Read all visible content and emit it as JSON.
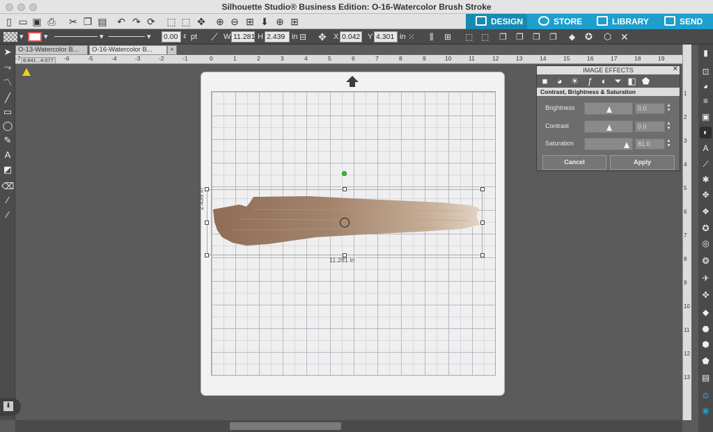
{
  "window": {
    "title": "Silhouette Studio® Business Edition: O-16-Watercolor Brush Stroke"
  },
  "nav_tabs": [
    {
      "label": "DESIGN",
      "icon": "grid-icon",
      "active": true
    },
    {
      "label": "STORE",
      "icon": "store-icon"
    },
    {
      "label": "LIBRARY",
      "icon": "library-icon"
    },
    {
      "label": "SEND",
      "icon": "send-icon"
    }
  ],
  "toolbar": {
    "line_width": "0.00",
    "line_unit": "pt",
    "w_label": "W",
    "w_value": "11.281",
    "h_label": "H",
    "h_value": "2.439",
    "size_unit": "in",
    "x_label": "X",
    "x_value": "0.042",
    "y_label": "Y",
    "y_value": "4.301",
    "pos_unit": "in"
  },
  "doc_tabs": [
    {
      "label": "O-13-Watercolor B..."
    },
    {
      "label": "O-16-Watercolor B..."
    },
    {
      "label": "+"
    }
  ],
  "ruler": {
    "h_ticks": [
      "-7",
      "-6",
      "-5",
      "-4",
      "-3",
      "-2",
      "-1",
      "0",
      "1",
      "2",
      "3",
      "4",
      "5",
      "6",
      "7",
      "8",
      "9",
      "10",
      "11",
      "12",
      "13",
      "14",
      "15",
      "16",
      "17",
      "18",
      "19"
    ],
    "v_ticks": [
      "1",
      "2",
      "3",
      "4",
      "5",
      "6",
      "7",
      "8",
      "9",
      "10",
      "11",
      "12",
      "13"
    ]
  },
  "coord_readout": "8.641 , 4.077",
  "selection": {
    "width_label": "11.281 in",
    "height_label": "2.439 in"
  },
  "image_effects": {
    "title": "IMAGE EFFECTS",
    "section": "Contrast, Brightness & Saturation",
    "brightness": {
      "label": "Brightness",
      "value": "0.0",
      "level": 0.5
    },
    "contrast": {
      "label": "Contrast",
      "value": "0.0",
      "level": 0.5
    },
    "saturation": {
      "label": "Saturation",
      "value": "81.0",
      "level": 0.905
    },
    "cancel": "Cancel",
    "apply": "Apply"
  },
  "colors": {
    "accent": "#1e9fcd",
    "brush": "#a98a72",
    "mat_border": "#e58e8e"
  }
}
